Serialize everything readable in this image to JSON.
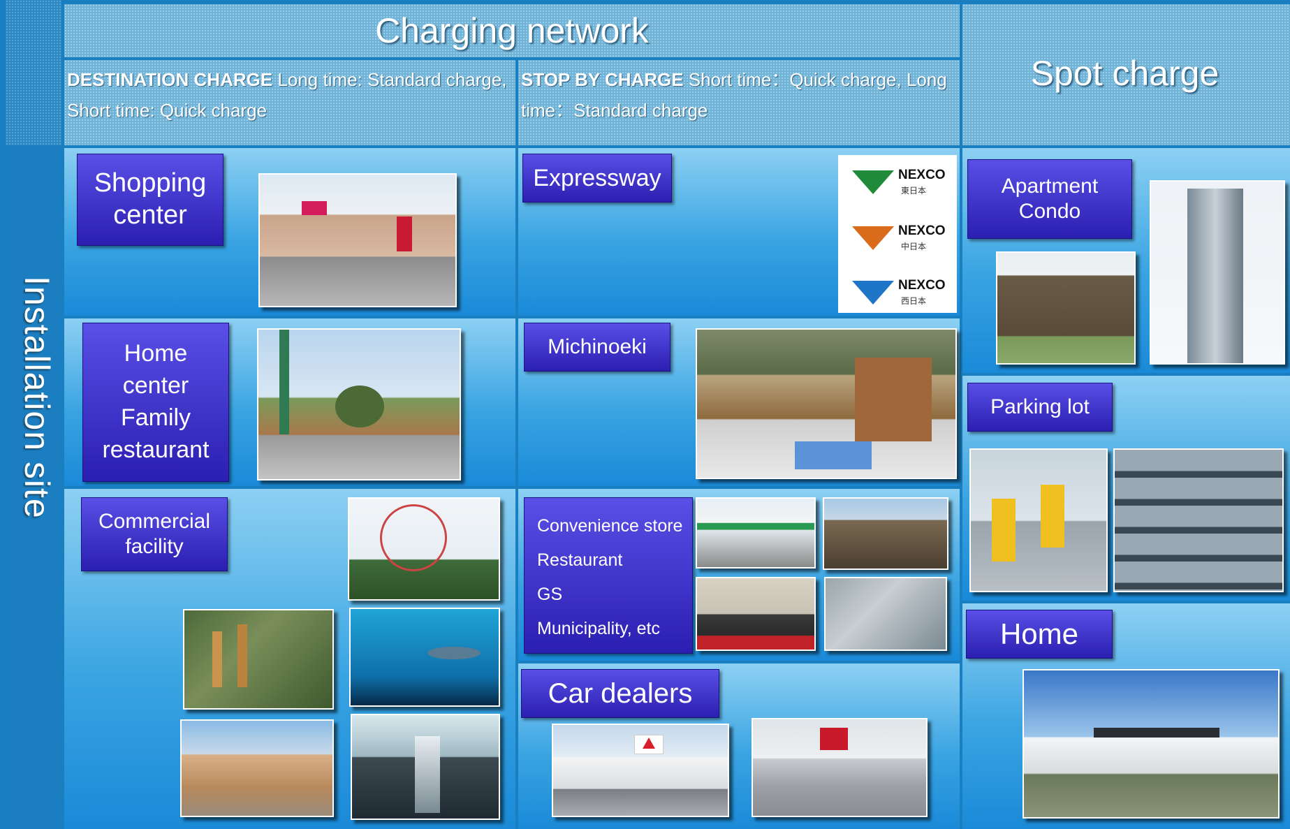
{
  "header": {
    "installation_site": "Installation site",
    "charging_network": "Charging network",
    "spot_charge": "Spot charge",
    "destination_bold": "DESTINATION CHARGE",
    "destination_text": " Long time: Standard charge, Short time: Quick charge",
    "stopby_bold": "STOP BY CHARGE",
    "stopby_text": " Short time：Quick charge, Long time：Standard charge"
  },
  "badges": {
    "shopping_line1": "Shopping",
    "shopping_line2": "center",
    "home_center_line1": "Home",
    "home_center_line2": "center",
    "home_center_line3": "Family",
    "home_center_line4": "restaurant",
    "commercial_line1": "Commercial",
    "commercial_line2": "facility",
    "expressway": "Expressway",
    "michinoeki": "Michinoeki",
    "convenience_items": [
      "Convenience store",
      "Restaurant",
      "GS",
      "Municipality, etc"
    ],
    "car_dealers": "Car dealers",
    "apartment_line1": "Apartment",
    "apartment_line2": "Condo",
    "parking_lot": "Parking lot",
    "home": "Home"
  },
  "logos": {
    "nexco": "NEXCO",
    "nexco_east": "東日本",
    "nexco_central": "中日本",
    "nexco_west": "西日本"
  },
  "colors": {
    "badge": "#3a30d0",
    "header": "#6fb4d8",
    "cell_top": "#8dd0f3",
    "cell_bottom": "#1a8ad8"
  }
}
